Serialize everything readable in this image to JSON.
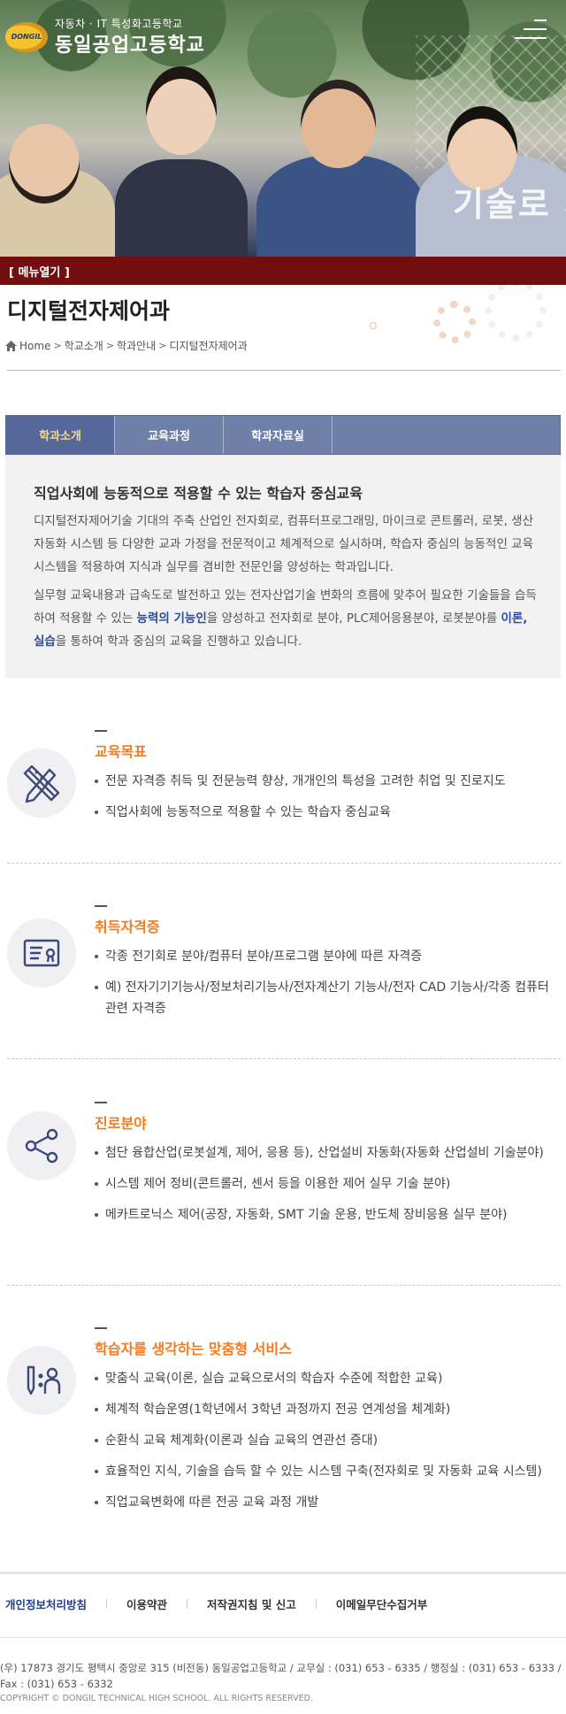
{
  "header": {
    "logo_mark_text": "DONGIL",
    "school_subtitle": "자동차 · IT 특성화고등학교",
    "school_name": "동일공업고등학교",
    "hero_slogan": "기술로 시"
  },
  "menu_bar": {
    "label": "[ 메뉴열기 ]"
  },
  "page": {
    "title": "디지털전자제어과",
    "breadcrumb": [
      "Home",
      "학교소개",
      "학과안내",
      "디지털전자제어과"
    ]
  },
  "tabs": [
    {
      "label": "학과소개",
      "active": true
    },
    {
      "label": "교육과정",
      "active": false
    },
    {
      "label": "학과자료실",
      "active": false
    }
  ],
  "intro": {
    "heading": "직업사회에 능동적으로 적용할 수 있는 학습자 중심교육",
    "p1": "디지털전자제어기술 기대의 주축 산업인 전자회로, 컴퓨터프로그래밍, 마이크로 콘트롤러, 로봇, 생산자동화 시스템 등 다양한 교과 가정을 전문적이고 체계적으로 실시하며, 학습자 중심의 능동적인 교육 시스템을 적용하여 지식과 실무를 겸비한 전문인을 양성하는 학과입니다.",
    "p2_a": "실무형 교육내용과 급속도로 발전하고 있는 전자산업기술 변화의 흐름에 맞추어 필요한 기술들을 습득하여 적용할 수 있는 ",
    "p2_hl1": "능력의 기능인",
    "p2_b": "을 양성하고 전자회로 분야, PLC제어응용분야, 로봇분야를 ",
    "p2_hl2": "이론, 실습",
    "p2_c": "을 통하여 학과 중심의 교육을 진행하고 있습니다."
  },
  "sections": [
    {
      "icon": "pencil-ruler-icon",
      "title": "교육목표",
      "items": [
        "전문 자격증 취득 및 전문능력 향상, 개개인의 특성을 고려한 취업 및 진로지도",
        "직업사회에 능동적으로 적용할 수 있는 학습자 중심교육"
      ]
    },
    {
      "icon": "certificate-icon",
      "title": "취득자격증",
      "items": [
        "각종 전기회로 분야/컴퓨터 분야/프로그램 분야에 따른 자격증",
        "예) 전자기기기능사/정보처리기능사/전자계산기 기능사/전자 CAD 기능사/각종 컴퓨터 관련 자격증"
      ]
    },
    {
      "icon": "share-icon",
      "title": "진로분야",
      "items": [
        "첨단 융합산업(로봇설계, 제어, 응용 등), 산업설비 자동화(자동화 산업설비 기술분야)",
        "시스템 제어 정비(콘트롤러, 센서 등을 이용한 제어 실무 기술 분야)",
        "메카트로닉스 제어(공장, 자동화, SMT 기술 운용, 반도체 장비응용 실무 분야)"
      ]
    },
    {
      "icon": "mentoring-icon",
      "title": "학습자를 생각하는 맞춤형 서비스",
      "items": [
        "맞춤식 교육(이론, 실습 교육으로서의 학습자 수준에 적합한 교육)",
        "체계적 학습운영(1학년에서 3학년 과정까지 전공 연계성을 체계화)",
        "순환식 교육 체계화(이론과 실습 교육의 연관선 증대)",
        "효율적인 지식, 기술을 습득 할 수 있는 시스템 구축(전자회로 및 자동화 교육 시스템)",
        "직업교육변화에 따른 전공 교육 과정 개발"
      ]
    }
  ],
  "footer": {
    "links": [
      "개인정보처리방침",
      "이용약관",
      "저작권지침 및 신고",
      "이메일무단수집거부"
    ],
    "address": "(우) 17873 경기도 평택시 중앙로 315 (비전동) 동일공업고등학교 / 교무실 : (031) 653 - 6335 / 행정실 : (031) 653 - 6333 / Fax : (031) 653 - 6332",
    "copyright": "COPYRIGHT © DONGIL TECHNICAL HIGH SCHOOL. ALL RIGHTS RESERVED."
  },
  "colors": {
    "accent_orange": "#f47b20",
    "menu_bar": "#720e0e",
    "tab_bg": "#6e7fa8",
    "tab_active_text": "#f5d889",
    "link_blue": "#2b4c9b"
  }
}
